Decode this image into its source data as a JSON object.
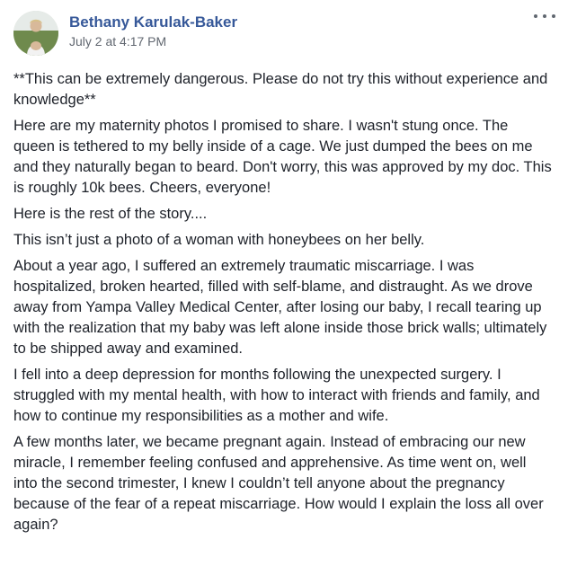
{
  "post": {
    "author": "Bethany Karulak-Baker",
    "timestamp": "July 2 at 4:17 PM",
    "paragraphs": [
      "**This can be extremely dangerous. Please do not try this without experience and knowledge**",
      "Here are my maternity photos I promised to share. I wasn't stung once. The queen is tethered to my belly inside of a cage. We just dumped the bees on me and they naturally began to beard. Don't worry, this was approved by my doc. This is roughly 10k bees. Cheers, everyone!",
      "Here is the rest of the story....",
      "This isn’t just a photo of a woman with honeybees on her belly.",
      "About a year ago, I suffered an extremely traumatic miscarriage. I was hospitalized, broken hearted, filled with self-blame, and distraught. As we drove away from Yampa Valley Medical Center, after losing our baby, I recall tearing up with the realization that my baby was left alone inside those brick walls; ultimately to be shipped away and examined.",
      "I fell into a deep depression for months following the unexpected surgery. I struggled with my mental health, with how to interact with friends and family, and how to continue my responsibilities as a mother and wife.",
      "A few months later, we became pregnant again. Instead of embracing our new miracle, I remember feeling confused and apprehensive. As time went on, well into the second trimester, I knew I couldn’t tell anyone about the pregnancy because of the fear of a repeat miscarriage. How would I explain the loss all over again?"
    ]
  },
  "icons": {
    "avatar": "profile-photo-avatar",
    "options": "more-options-icon"
  },
  "colors": {
    "author_link": "#365899",
    "timestamp": "#616770",
    "body_text": "#1d2129"
  }
}
